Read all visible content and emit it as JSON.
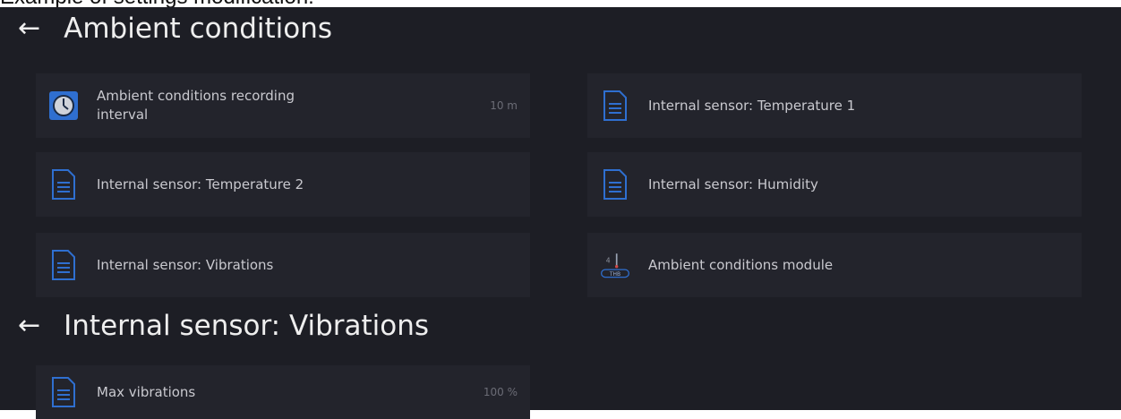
{
  "caption": "Example of settings modification:",
  "screen1": {
    "title": "Ambient conditions",
    "items": [
      {
        "label": "Ambient conditions recording interval",
        "value": "10 m"
      },
      {
        "label": "Internal sensor: Temperature 1"
      },
      {
        "label": "Internal sensor: Temperature 2"
      },
      {
        "label": "Internal sensor: Humidity"
      },
      {
        "label": "Internal sensor: Vibrations"
      },
      {
        "label": "Ambient conditions module",
        "badge": "THB"
      }
    ]
  },
  "screen2": {
    "title": "Internal sensor: Vibrations",
    "items": [
      {
        "label": "Max vibrations",
        "value": "100 %"
      }
    ]
  },
  "colors": {
    "background": "#1d1e25",
    "tile": "#23242c",
    "icon_blue": "#2f6fd0",
    "text": "#c9c9cf"
  }
}
